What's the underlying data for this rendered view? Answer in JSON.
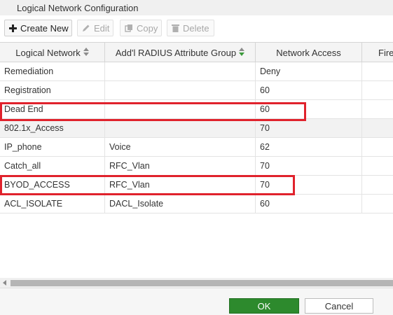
{
  "window": {
    "title": "Logical Network Configuration"
  },
  "toolbar": {
    "create_new": "Create New",
    "edit": "Edit",
    "copy": "Copy",
    "delete": "Delete"
  },
  "table": {
    "columns": [
      "Logical Network",
      "Add'l RADIUS Attribute Group",
      "Network Access",
      "Fire"
    ],
    "rows": [
      {
        "logical_network": "Remediation",
        "radius_group": "",
        "network_access": "Deny"
      },
      {
        "logical_network": "Registration",
        "radius_group": "",
        "network_access": "60"
      },
      {
        "logical_network": "Dead End",
        "radius_group": "",
        "network_access": "60"
      },
      {
        "logical_network": "802.1x_Access",
        "radius_group": "",
        "network_access": "70"
      },
      {
        "logical_network": "IP_phone",
        "radius_group": "Voice",
        "network_access": "62"
      },
      {
        "logical_network": "Catch_all",
        "radius_group": "RFC_Vlan",
        "network_access": "70"
      },
      {
        "logical_network": "BYOD_ACCESS",
        "radius_group": "RFC_Vlan",
        "network_access": "70"
      },
      {
        "logical_network": "ACL_ISOLATE",
        "radius_group": "DACL_Isolate",
        "network_access": "60"
      }
    ]
  },
  "footer": {
    "ok": "OK",
    "cancel": "Cancel"
  },
  "colors": {
    "highlight": "#e0222c",
    "ok_button": "#2d8a2d",
    "sort_active": "#3a9a3a"
  }
}
